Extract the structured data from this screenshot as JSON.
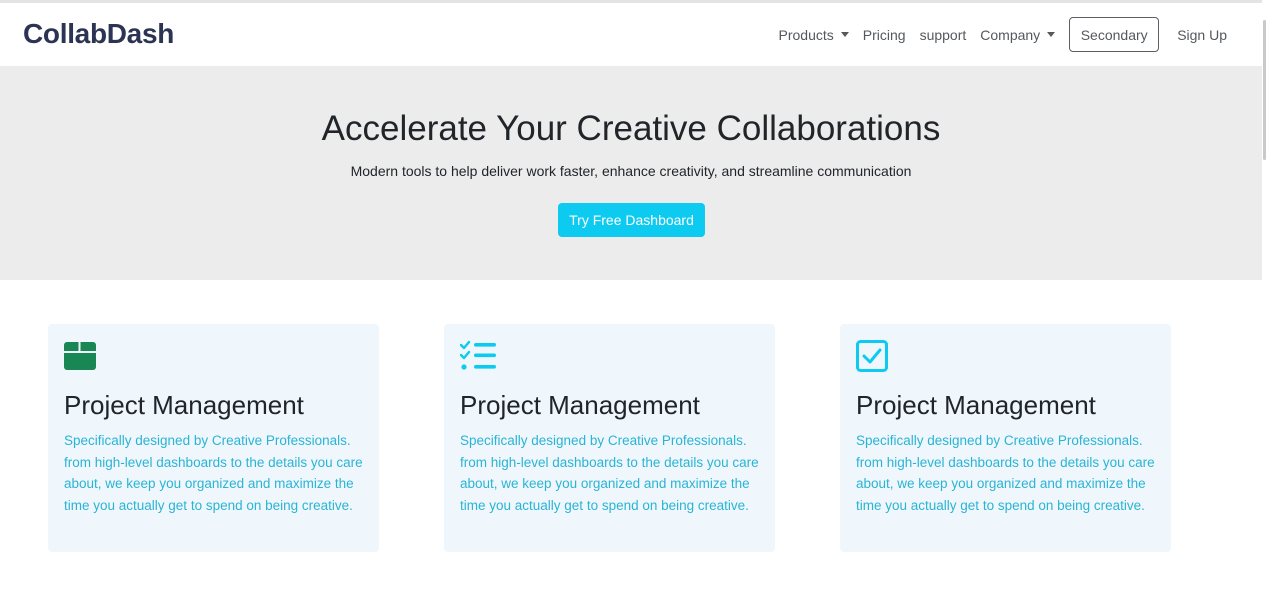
{
  "brand": {
    "name": "CollabDash"
  },
  "nav": {
    "products": "Products",
    "pricing": "Pricing",
    "support": "support",
    "company": "Company",
    "secondary_button": "Secondary",
    "signup": "Sign Up"
  },
  "hero": {
    "title": "Accelerate Your Creative Collaborations",
    "subtitle": "Modern tools to help deliver work faster, enhance creativity, and streamline communication",
    "cta_label": "Try Free Dashboard"
  },
  "cards": [
    {
      "icon": "box-icon",
      "title": "Project Management",
      "text": "Specifically designed by Creative Professionals. from high-level dashboards to the details you care about, we keep you organized and maximize the time you actually get to spend on being creative."
    },
    {
      "icon": "checklist-icon",
      "title": "Project Management",
      "text": "Specifically designed by Creative Professionals. from high-level dashboards to the details you care about, we keep you organized and maximize the time you actually get to spend on being creative."
    },
    {
      "icon": "check-square-icon",
      "title": "Project Management",
      "text": "Specifically designed by Creative Professionals. from high-level dashboards to the details you care about, we keep you organized and maximize the time you actually get to spend on being creative."
    }
  ],
  "colors": {
    "brand": "#2b3553",
    "accent": "#0dcaf0",
    "card_text": "#2ab4d4",
    "card_bg": "#eff7fd",
    "hero_bg": "#ececec",
    "box_icon": "#198754"
  }
}
